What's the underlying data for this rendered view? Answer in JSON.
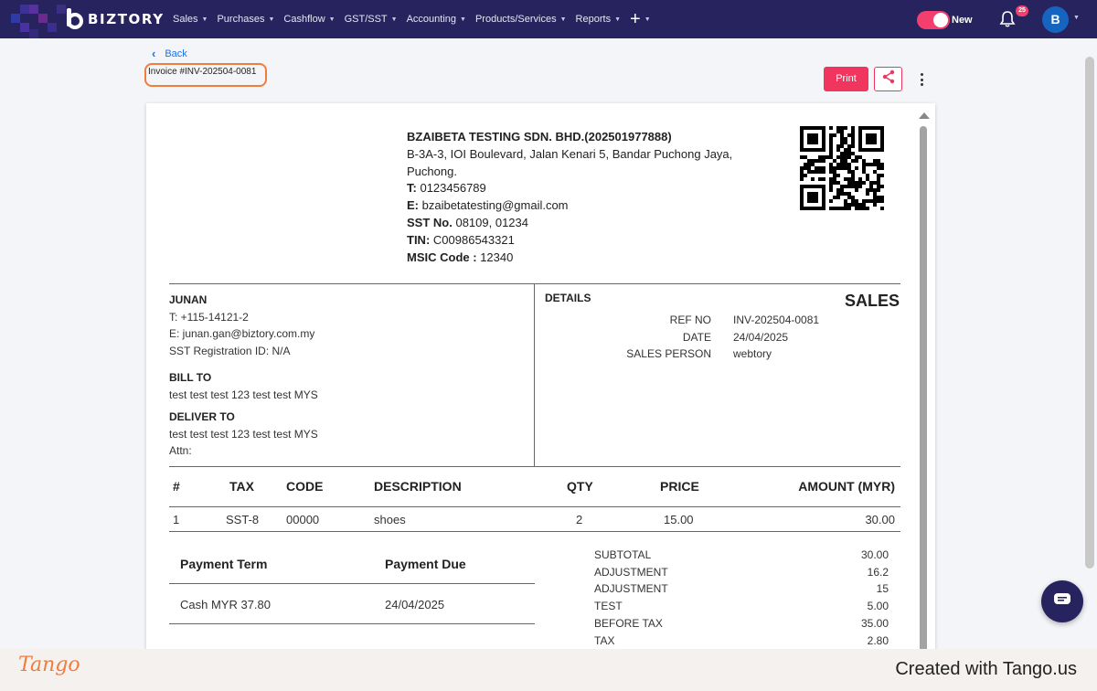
{
  "nav": {
    "brand": "BIZTORY",
    "menu": [
      {
        "label": "Sales"
      },
      {
        "label": "Purchases"
      },
      {
        "label": "Cashflow"
      },
      {
        "label": "GST/SST"
      },
      {
        "label": "Accounting"
      },
      {
        "label": "Products/Services"
      },
      {
        "label": "Reports"
      }
    ],
    "toggle_label": "New",
    "notification_count": "25",
    "avatar_initial": "B"
  },
  "header": {
    "back_label": "Back",
    "invoice_title": "Invoice #INV-202504-0081",
    "print_label": "Print"
  },
  "company": {
    "name": "BZAIBETA TESTING SDN. BHD.(202501977888)",
    "address_line1": "B-3A-3, IOI Boulevard, Jalan Kenari 5, Bandar Puchong Jaya,",
    "address_line2": "Puchong.",
    "phone_label": "T:",
    "phone": "0123456789",
    "email_label": "E:",
    "email": "bzaibetatesting@gmail.com",
    "sst_label": "SST No.",
    "sst": "08109, 01234",
    "tin_label": "TIN:",
    "tin": "C00986543321",
    "msic_label": "MSIC Code :",
    "msic": "12340"
  },
  "customer": {
    "name": "JUNAN",
    "phone": "T: +115-14121-2",
    "email": "E: junan.gan@biztory.com.my",
    "sst": "SST Registration ID: N/A",
    "bill_to_label": "BILL TO",
    "bill_to": "test test test 123 test test MYS",
    "deliver_to_label": "DELIVER TO",
    "deliver_to": "test test test 123 test test MYS",
    "attn": "Attn:"
  },
  "details": {
    "label": "DETAILS",
    "doc_type": "SALES",
    "rows": [
      {
        "key": "REF NO",
        "value": "INV-202504-0081"
      },
      {
        "key": "DATE",
        "value": "24/04/2025"
      },
      {
        "key": "SALES PERSON",
        "value": "webtory"
      }
    ]
  },
  "items": {
    "headers": {
      "num": "#",
      "tax": "TAX",
      "code": "CODE",
      "description": "DESCRIPTION",
      "qty": "QTY",
      "price": "PRICE",
      "amount": "AMOUNT (MYR)"
    },
    "rows": [
      {
        "num": "1",
        "tax": "SST-8",
        "code": "00000",
        "description": "shoes",
        "qty": "2",
        "price": "15.00",
        "amount": "30.00"
      }
    ]
  },
  "payment": {
    "term_label": "Payment Term",
    "due_label": "Payment Due",
    "term": "Cash MYR 37.80",
    "due": "24/04/2025"
  },
  "totals": [
    {
      "label": "SUBTOTAL",
      "value": "30.00"
    },
    {
      "label": "ADJUSTMENT",
      "value": "16.2"
    },
    {
      "label": "ADJUSTMENT",
      "value": "15"
    },
    {
      "label": "TEST",
      "value": "5.00"
    },
    {
      "label": "BEFORE TAX",
      "value": "35.00"
    },
    {
      "label": "TAX",
      "value": "2.80"
    }
  ],
  "footer": {
    "brand": "Tango",
    "created": "Created with Tango.us"
  },
  "colors": {
    "nav_bg": "#27235e",
    "accent": "#f0365f",
    "highlight": "#f07d3c",
    "link": "#1a73e8"
  }
}
